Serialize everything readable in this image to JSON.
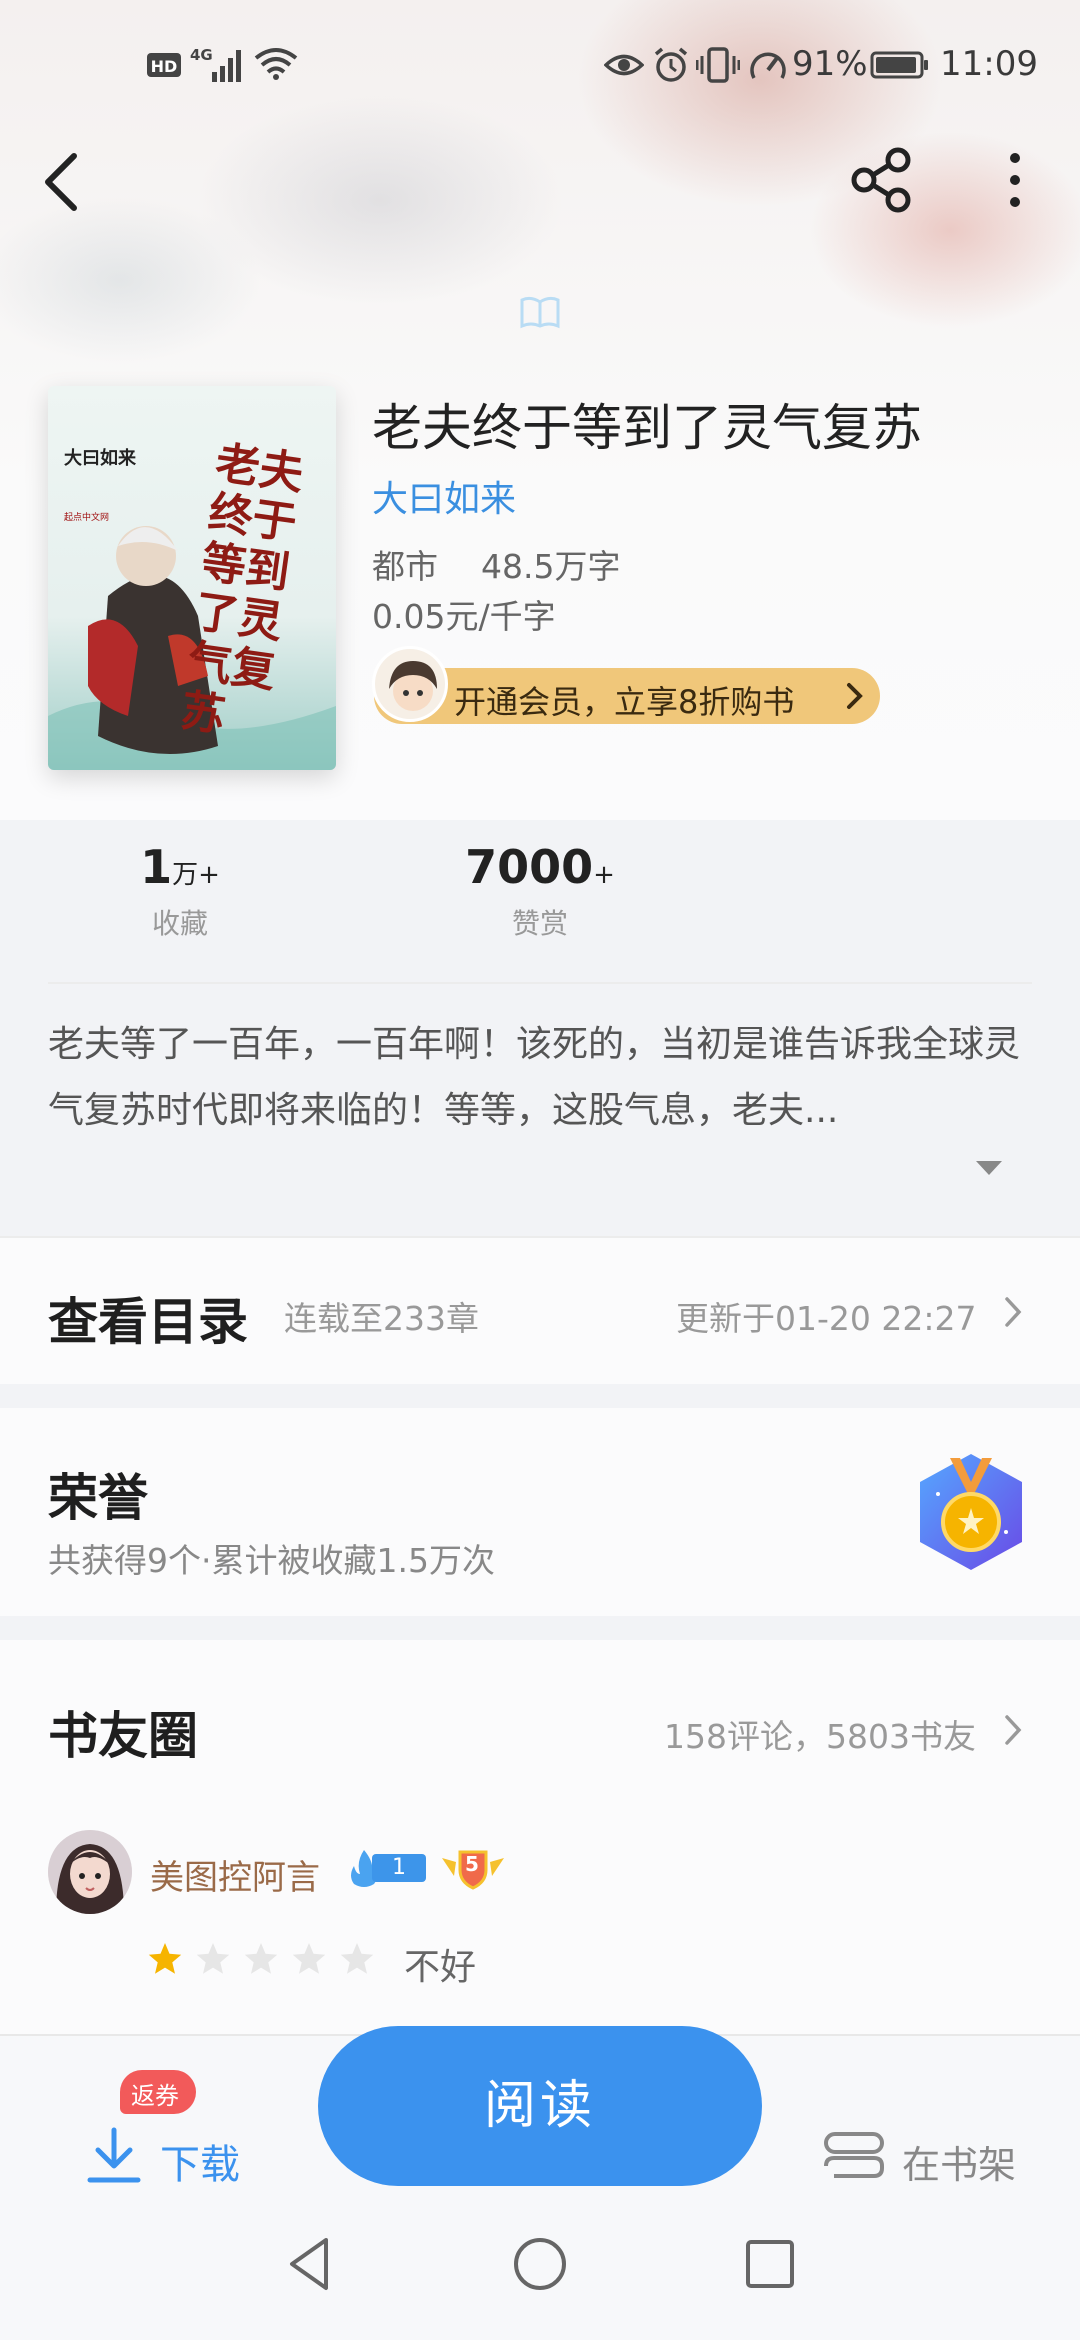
{
  "status_bar": {
    "left_icons": [
      "hd-icon",
      "4g-signal-icon",
      "wifi-icon"
    ],
    "battery": "91%",
    "time": "11:09"
  },
  "top_bar": {
    "back_icon": "back-chevron-icon",
    "share_icon": "share-icon",
    "more_icon": "more-vertical-icon"
  },
  "book": {
    "title": "老夫终于等到了灵气复苏",
    "author": "大曰如来",
    "category": "都市",
    "word_count": "48.5万字",
    "price": "0.05元/千字",
    "cover": {
      "author_text": "大曰如来",
      "title_text": "老夫终于等到了灵气复苏",
      "publisher_text": "起点中文网"
    }
  },
  "vip_banner": {
    "label": "开通会员，立享8折购书"
  },
  "stats": [
    {
      "num": "1",
      "unit": "万+",
      "label": "收藏"
    },
    {
      "num": "7000",
      "unit": "+",
      "label": "赞赏"
    }
  ],
  "description": "老夫等了一百年，一百年啊！该死的，当初是谁告诉我全球灵气复苏时代即将来临的！等等，这股气息，老夫...",
  "catalog": {
    "title": "查看目录",
    "status": "连载至233章",
    "updated": "更新于01-20 22:27"
  },
  "honor": {
    "title": "荣誉",
    "summary": "共获得9个·累计被收藏1.5万次"
  },
  "community": {
    "title": "书友圈",
    "summary": "158评论，5803书友",
    "review": {
      "username": "美图控阿言",
      "fan_level": "1",
      "badge_level": "5",
      "rating": 1,
      "rating_max": 5,
      "rating_text": "不好"
    }
  },
  "bottom_bar": {
    "download_badge": "返券",
    "download_label": "下载",
    "read_label": "阅读",
    "shelf_label": "在书架"
  },
  "colors": {
    "accent": "#3b92ee",
    "author_link": "#3a8fe0",
    "vip_gold": "#f0c77a",
    "star_active": "#f6b400",
    "badge_red": "#f25a5a"
  }
}
